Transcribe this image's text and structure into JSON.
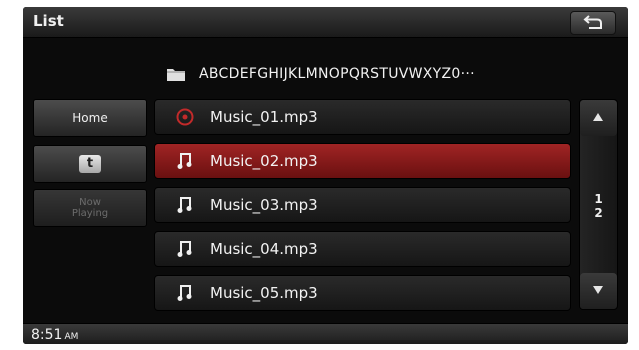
{
  "header": {
    "title": "List"
  },
  "path": {
    "text": "ABCDEFGHIJKLMNOPQRSTUVWXYZ0···"
  },
  "sidebar": {
    "home_label": "Home",
    "t_label": "t",
    "now_playing_line1": "Now",
    "now_playing_line2": "Playing"
  },
  "files": [
    {
      "name": "Music_01.mp3",
      "icon": "playing-disc-icon",
      "selected": false
    },
    {
      "name": "Music_02.mp3",
      "icon": "music-note-icon",
      "selected": true
    },
    {
      "name": "Music_03.mp3",
      "icon": "music-note-icon",
      "selected": false
    },
    {
      "name": "Music_04.mp3",
      "icon": "music-note-icon",
      "selected": false
    },
    {
      "name": "Music_05.mp3",
      "icon": "music-note-icon",
      "selected": false
    }
  ],
  "pagination": {
    "current": "1",
    "total": "2"
  },
  "status": {
    "time": "8:51",
    "ampm": "AM"
  },
  "colors": {
    "selected_row": "#a02424",
    "background": "#0b0b0b"
  }
}
